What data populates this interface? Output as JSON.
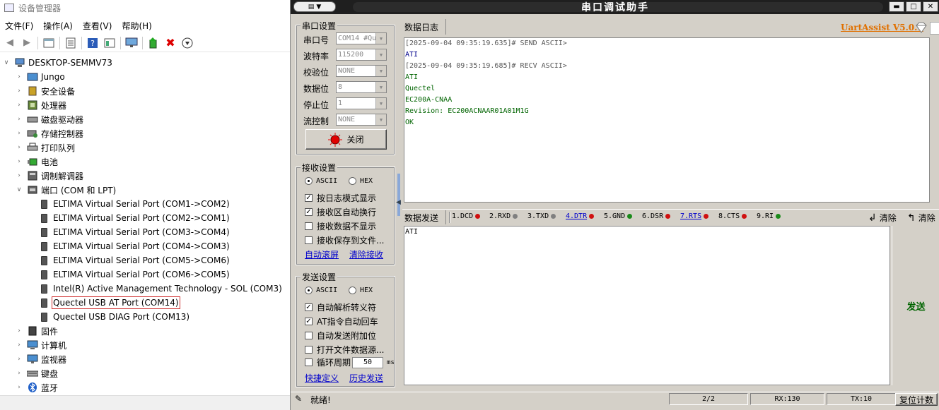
{
  "device_manager": {
    "title": "设备管理器",
    "menu": [
      "文件(F)",
      "操作(A)",
      "查看(V)",
      "帮助(H)"
    ],
    "root": "DESKTOP-SEMMV73",
    "categories_top": [
      "Jungo",
      "安全设备",
      "处理器",
      "磁盘驱动器",
      "存储控制器",
      "打印队列",
      "电池",
      "调制解调器"
    ],
    "ports_category": "端口 (COM 和 LPT)",
    "ports": [
      "ELTIMA Virtual Serial Port (COM1->COM2)",
      "ELTIMA Virtual Serial Port (COM2->COM1)",
      "ELTIMA Virtual Serial Port (COM3->COM4)",
      "ELTIMA Virtual Serial Port (COM4->COM3)",
      "ELTIMA Virtual Serial Port (COM5->COM6)",
      "ELTIMA Virtual Serial Port (COM6->COM5)",
      "Intel(R) Active Management Technology - SOL (COM3)",
      "Quectel USB AT Port (COM14)",
      "Quectel USB DIAG Port (COM13)"
    ],
    "categories_bottom": [
      "固件",
      "计算机",
      "监视器",
      "键盘",
      "蓝牙"
    ]
  },
  "uart": {
    "title": "串口调试助手",
    "sysmenu_icon": "",
    "brand": "UartAssist V5.0.1",
    "serial_group": "串口设置",
    "serial_labels": [
      "串口号",
      "波特率",
      "校验位",
      "数据位",
      "停止位",
      "流控制"
    ],
    "serial_values": [
      "COM14 #Qu",
      "115200",
      "NONE",
      "8",
      "1",
      "NONE"
    ],
    "close_button": "关闭",
    "recv_group": "接收设置",
    "recv_ascii": "ASCII",
    "recv_hex": "HEX",
    "recv_options": [
      "按日志模式显示",
      "接收区自动换行",
      "接收数据不显示",
      "接收保存到文件..."
    ],
    "recv_links": [
      "自动滚屏",
      "清除接收"
    ],
    "send_group": "发送设置",
    "send_ascii": "ASCII",
    "send_hex": "HEX",
    "send_options": [
      "自动解析转义符",
      "AT指令自动回车",
      "自动发送附加位",
      "打开文件数据源..."
    ],
    "loop_label": "循环周期",
    "loop_value": "50",
    "loop_unit": "ms",
    "send_links": [
      "快捷定义",
      "历史发送"
    ],
    "log_tab": "数据日志",
    "log_lines": [
      {
        "kind": "blank",
        "text": ""
      },
      {
        "kind": "send",
        "text": "[2025-09-04 09:35:19.635]# SEND ASCII>"
      },
      {
        "kind": "sdata",
        "text": "ATI"
      },
      {
        "kind": "blank",
        "text": ""
      },
      {
        "kind": "blank",
        "text": ""
      },
      {
        "kind": "recv",
        "text": "[2025-09-04 09:35:19.685]# RECV ASCII>"
      },
      {
        "kind": "rdata",
        "text": "ATI"
      },
      {
        "kind": "rdata",
        "text": "Quectel"
      },
      {
        "kind": "rdata",
        "text": "EC200A-CNAA"
      },
      {
        "kind": "rdata",
        "text": "Revision: EC200ACNAAR01A01M1G"
      },
      {
        "kind": "blank",
        "text": ""
      },
      {
        "kind": "rdata",
        "text": "OK"
      }
    ],
    "send_tab": "数据发送",
    "signals": [
      {
        "label": "1.DCD",
        "color": "#d01010",
        "link": false
      },
      {
        "label": "2.RXD",
        "color": "#808080",
        "link": false
      },
      {
        "label": "3.TXD",
        "color": "#808080",
        "link": false
      },
      {
        "label": "4.DTR",
        "color": "#d01010",
        "link": true
      },
      {
        "label": "5.GND",
        "color": "#1a8a1a",
        "link": false
      },
      {
        "label": "6.DSR",
        "color": "#d01010",
        "link": false
      },
      {
        "label": "7.RTS",
        "color": "#d01010",
        "link": true
      },
      {
        "label": "8.CTS",
        "color": "#d01010",
        "link": false
      },
      {
        "label": "9.RI",
        "color": "#1a8a1a",
        "link": false
      }
    ],
    "clear_label_1": "清除",
    "clear_label_2": "清除",
    "send_text": "ATI",
    "send_button": "发送",
    "status_text": "就绪!",
    "status_count": "2/2",
    "rx": "RX:130",
    "tx": "TX:10",
    "reset_button": "复位计数"
  }
}
